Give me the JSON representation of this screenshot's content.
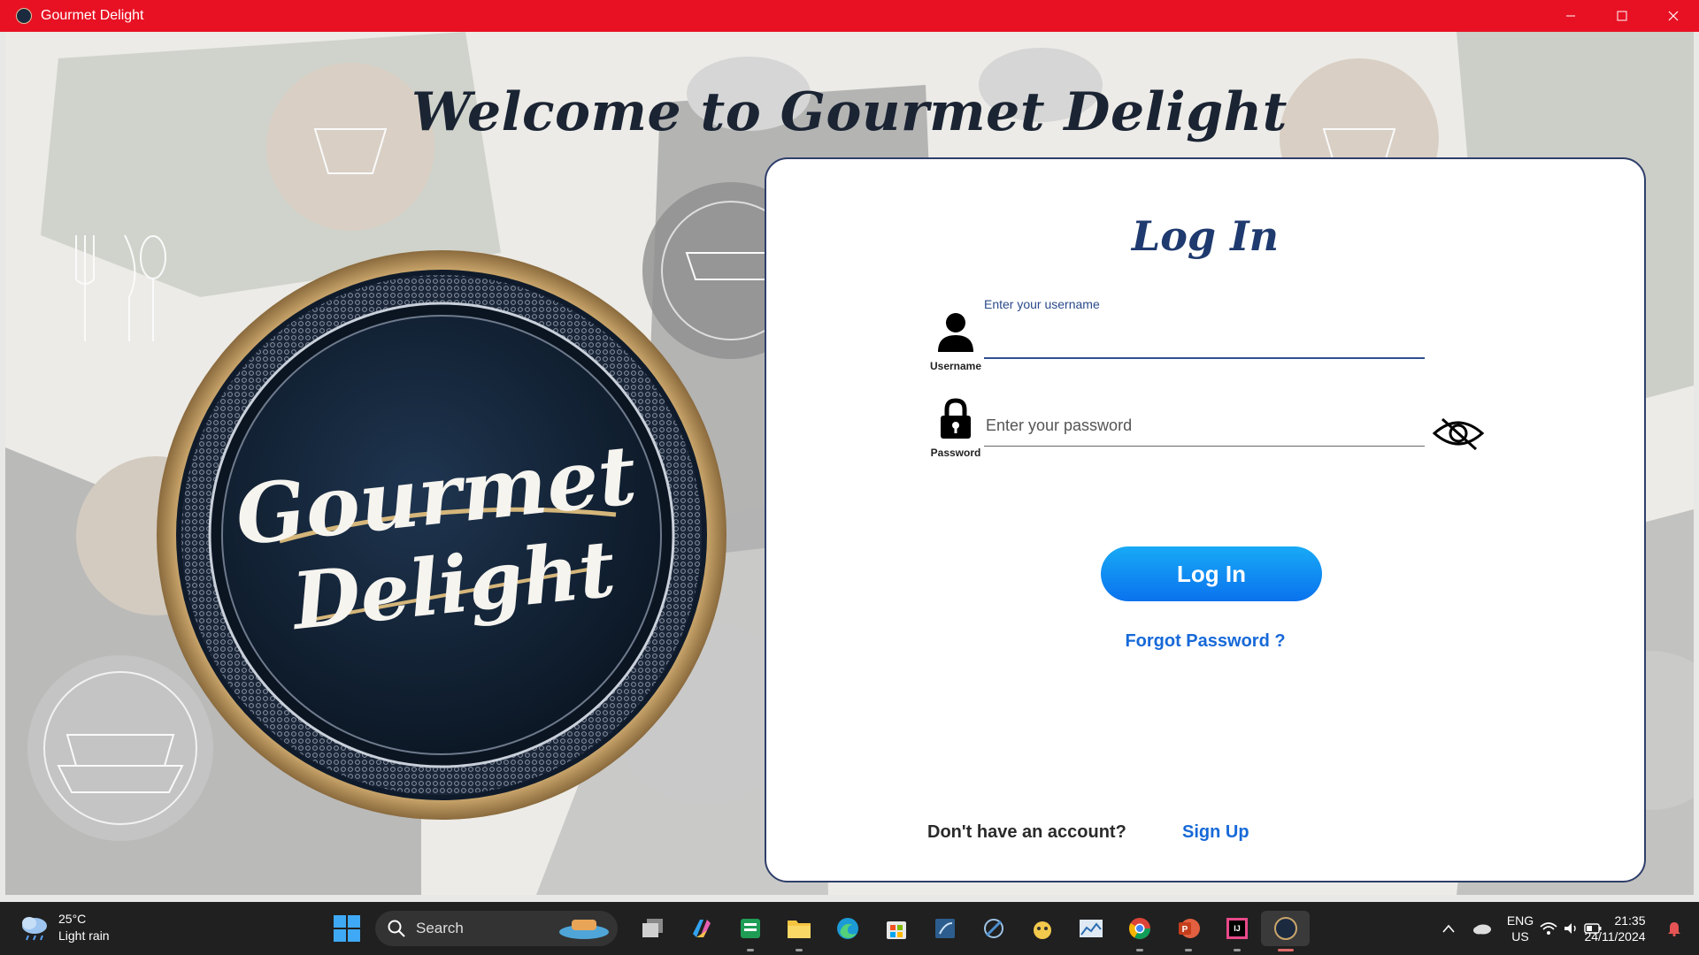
{
  "window": {
    "title": "Gourmet Delight"
  },
  "hero": {
    "welcome": "Welcome to Gourmet Delight",
    "logo_line1": "Gourmet",
    "logo_line2": "Delight"
  },
  "login": {
    "title": "Log In",
    "username_label": "Username",
    "username_float": "Enter your username",
    "password_label": "Password",
    "password_placeholder": "Enter your password",
    "login_button": "Log In",
    "forgot": "Forgot Password ?",
    "no_account": "Don't have an account?",
    "signup": "Sign Up"
  },
  "taskbar": {
    "weather_temp": "25°C",
    "weather_desc": "Light rain",
    "search": "Search",
    "lang1": "ENG",
    "lang2": "US",
    "time": "21:35",
    "date": "24/11/2024",
    "apps": [
      "task-view-icon",
      "copilot-icon",
      "sheets-icon",
      "file-explorer-icon",
      "edge-icon",
      "store-icon",
      "database-icon",
      "compass-icon",
      "game-icon",
      "monitor-icon",
      "chrome-icon",
      "powerpoint-icon",
      "intellij-icon",
      "gourmet-app-icon"
    ]
  },
  "colors": {
    "title_bar": "#e81123",
    "primary": "#1769d8",
    "navy": "#1f3a6f",
    "card_border": "#2f3f6a"
  }
}
